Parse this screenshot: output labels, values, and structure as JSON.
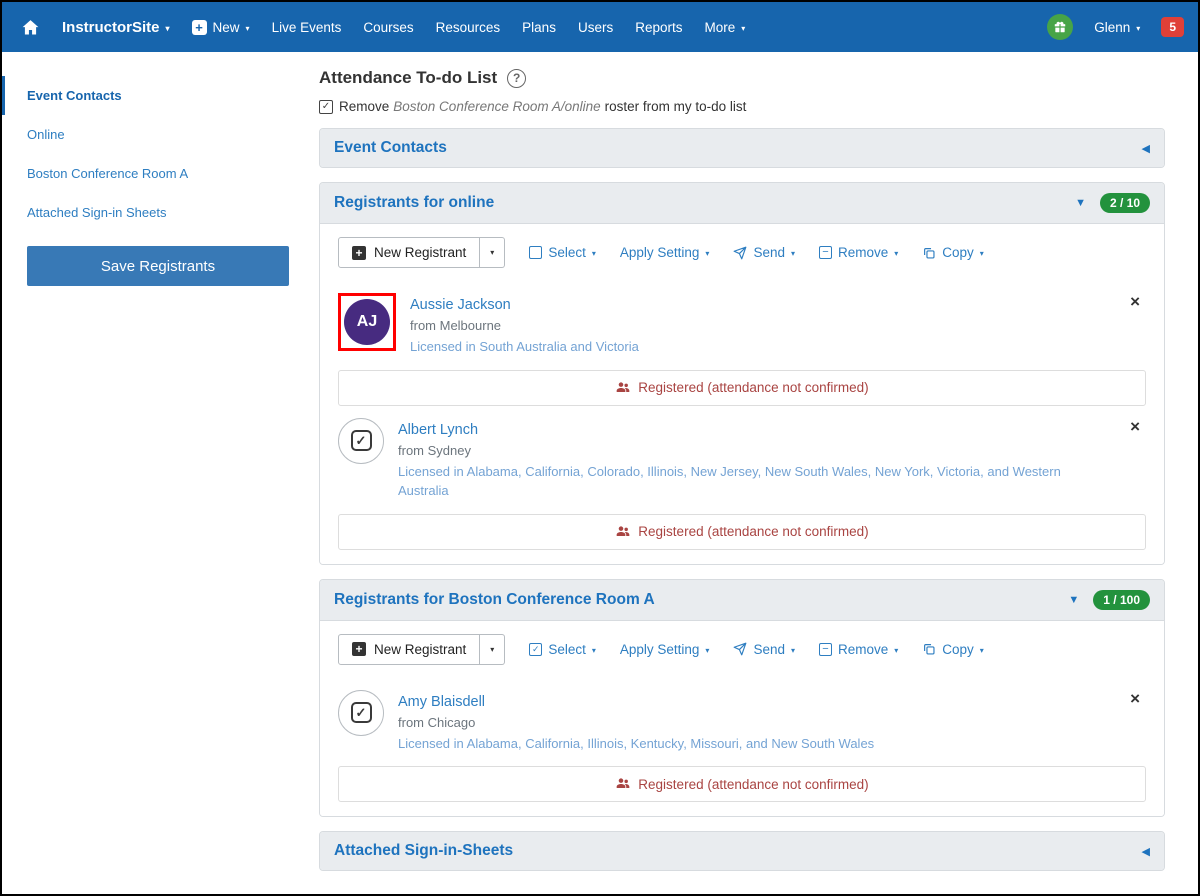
{
  "icons": {
    "caret_down": "▾",
    "collapse_left": "◀",
    "expanded_down": "▼",
    "close": "×",
    "check": "✓",
    "question": "?",
    "plus": "+",
    "minus": "−"
  },
  "navbar": {
    "brand": "InstructorSite",
    "new_label": "New",
    "links": [
      "Live Events",
      "Courses",
      "Resources",
      "Plans",
      "Users",
      "Reports"
    ],
    "more_label": "More",
    "user_name": "Glenn",
    "notification_count": "5"
  },
  "sidebar": {
    "items": [
      {
        "label": "Event Contacts"
      },
      {
        "label": "Online"
      },
      {
        "label": "Boston Conference Room A"
      },
      {
        "label": "Attached Sign-in Sheets"
      }
    ],
    "save_button_label": "Save Registrants"
  },
  "page": {
    "title": "Attendance To-do List",
    "todo_prefix": "Remove",
    "todo_event": "Boston Conference Room A/online",
    "todo_suffix": "roster from my to-do list"
  },
  "toolbar": {
    "new_registrant": "New Registrant",
    "select": "Select",
    "apply_setting": "Apply Setting",
    "send": "Send",
    "remove": "Remove",
    "copy": "Copy"
  },
  "panels": {
    "event_contacts": {
      "title": "Event Contacts"
    },
    "online": {
      "title": "Registrants for online",
      "badge": "2 / 10",
      "registrants": [
        {
          "initials": "AJ",
          "name": "Aussie Jackson",
          "from": "from Melbourne",
          "licensed": "Licensed in South Australia and Victoria",
          "status": "Registered (attendance not confirmed)"
        },
        {
          "name": "Albert Lynch",
          "from": "from Sydney",
          "licensed": "Licensed in Alabama, California, Colorado, Illinois, New Jersey, New South Wales, New York, Victoria, and Western Australia",
          "status": "Registered (attendance not confirmed)"
        }
      ]
    },
    "boston": {
      "title": "Registrants for Boston Conference Room A",
      "badge": "1 / 100",
      "registrants": [
        {
          "name": "Amy Blaisdell",
          "from": "from Chicago",
          "licensed": "Licensed in Alabama, California, Illinois, Kentucky, Missouri, and New South Wales",
          "status": "Registered (attendance not confirmed)"
        }
      ]
    },
    "sheets": {
      "title": "Attached Sign-in-Sheets"
    }
  }
}
